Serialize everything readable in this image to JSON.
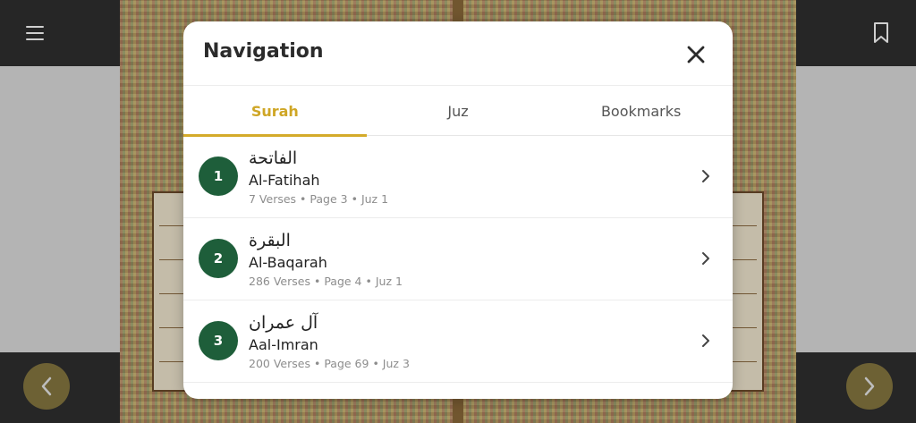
{
  "modal": {
    "title": "Navigation",
    "close_icon": "close-icon"
  },
  "tabs": [
    {
      "label": "Surah",
      "active": true
    },
    {
      "label": "Juz",
      "active": false
    },
    {
      "label": "Bookmarks",
      "active": false
    }
  ],
  "surahs": [
    {
      "number": "1",
      "arabic": "الفاتحة",
      "name": "Al-Fatihah",
      "verses": "7 Verses",
      "page": "Page 3",
      "juz": "Juz 1"
    },
    {
      "number": "2",
      "arabic": "البقرة",
      "name": "Al-Baqarah",
      "verses": "286 Verses",
      "page": "Page 4",
      "juz": "Juz 1"
    },
    {
      "number": "3",
      "arabic": "آل عمران",
      "name": "Aal-Imran",
      "verses": "200 Verses",
      "page": "Page 69",
      "juz": "Juz 3"
    }
  ],
  "separator": "•",
  "colors": {
    "accent": "#d4ab2a",
    "badge": "#1e5e3a",
    "bar": "#2f2f2f"
  },
  "icons": {
    "menu": "menu-icon",
    "bookmark": "bookmark-icon",
    "prev": "chevron-left-icon",
    "next": "chevron-right-icon"
  }
}
